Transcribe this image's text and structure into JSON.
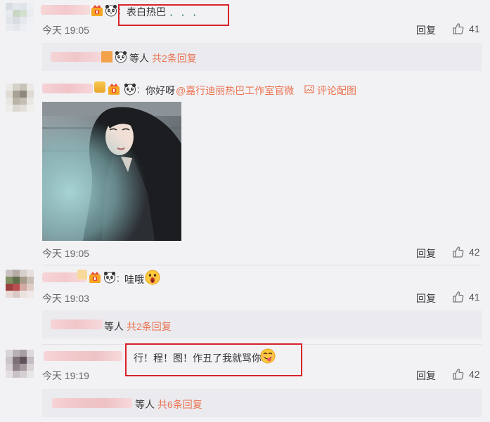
{
  "colors": {
    "page_bg": "#f2f2f5",
    "link": "#eb7350",
    "sub_bg": "#eaeaef",
    "highlight_box": "#d8232a"
  },
  "comments": [
    {
      "text": "表白热巴",
      "trailing": "˛ ˛ ˛",
      "time": "今天 19:05",
      "reply_label": "回复",
      "likes": "41",
      "sub": {
        "suffix": "等人",
        "link": "共2条回复"
      }
    },
    {
      "text": "你好呀",
      "mention": "@嘉行迪丽热巴工作室官微",
      "image_link": "评论配图",
      "time": "今天 19:05",
      "reply_label": "回复",
      "likes": "42"
    },
    {
      "text": "哇哦",
      "time": "今天 19:03",
      "reply_label": "回复",
      "likes": "41",
      "sub": {
        "suffix": "等人",
        "link": "共2条回复"
      }
    },
    {
      "text": "行！程！图！作丑了我就骂你",
      "time": "今天 19:19",
      "reply_label": "回复",
      "likes": "42",
      "sub": {
        "suffix": "等人",
        "link": "共6条回复"
      }
    }
  ]
}
